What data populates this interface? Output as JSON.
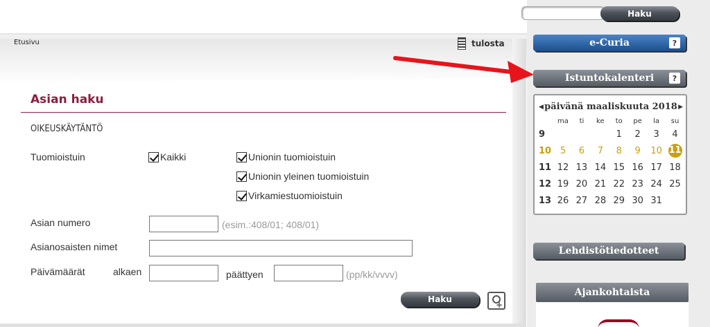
{
  "breadcrumb": "Etusivu",
  "print_label": "tulosta",
  "page_title": "Asian haku",
  "section_heading": "OIKEUSKÄYTÄNTÖ",
  "court": {
    "label": "Tuomioistuin",
    "options": [
      {
        "label": "Kaikki",
        "checked": true
      },
      {
        "label": "Unionin tuomioistuin",
        "checked": true
      },
      {
        "label": "Unionin yleinen tuomioistuin",
        "checked": true
      },
      {
        "label": "Virkamiestuomioistuin",
        "checked": true
      }
    ]
  },
  "case_number": {
    "label": "Asian numero",
    "value": "",
    "hint": "(esim.:408/01; 408/01)"
  },
  "parties": {
    "label": "Asianosaisten nimet",
    "value": ""
  },
  "dates": {
    "label": "Päivämäärät",
    "from_label": "alkaen",
    "from_value": "",
    "to_label": "päättyen",
    "to_value": "",
    "hint": "(pp/kk/vvvv)"
  },
  "search_button": "Haku",
  "sidebar": {
    "search_value": "",
    "search_button": "Haku",
    "ecuria": "e-Curia",
    "calendar_button": "Istuntokalenteri",
    "help": "?",
    "press_button": "Lehdistötiedotteet",
    "current_button": "Ajankohtaista"
  },
  "calendar": {
    "heading": "päivänä maaliskuuta 2018",
    "weekdays": [
      "ma",
      "ti",
      "ke",
      "to",
      "pe",
      "la",
      "su"
    ],
    "weeks": [
      {
        "week": "9",
        "days": [
          "",
          "",
          "",
          "1",
          "2",
          "3",
          "4"
        ]
      },
      {
        "week": "10",
        "days": [
          "5",
          "6",
          "7",
          "8",
          "9",
          "10",
          "11"
        ]
      },
      {
        "week": "11",
        "days": [
          "12",
          "13",
          "14",
          "15",
          "16",
          "17",
          "18"
        ]
      },
      {
        "week": "12",
        "days": [
          "19",
          "20",
          "21",
          "22",
          "23",
          "24",
          "25"
        ]
      },
      {
        "week": "13",
        "days": [
          "26",
          "27",
          "28",
          "29",
          "30",
          "31",
          ""
        ]
      }
    ],
    "highlight_week": "10",
    "today": "11",
    "highlight_color": "#c9a010"
  },
  "colors": {
    "title": "#8b1e3f",
    "arrow": "#e8141b",
    "ecuria": "#1d4f8d"
  }
}
